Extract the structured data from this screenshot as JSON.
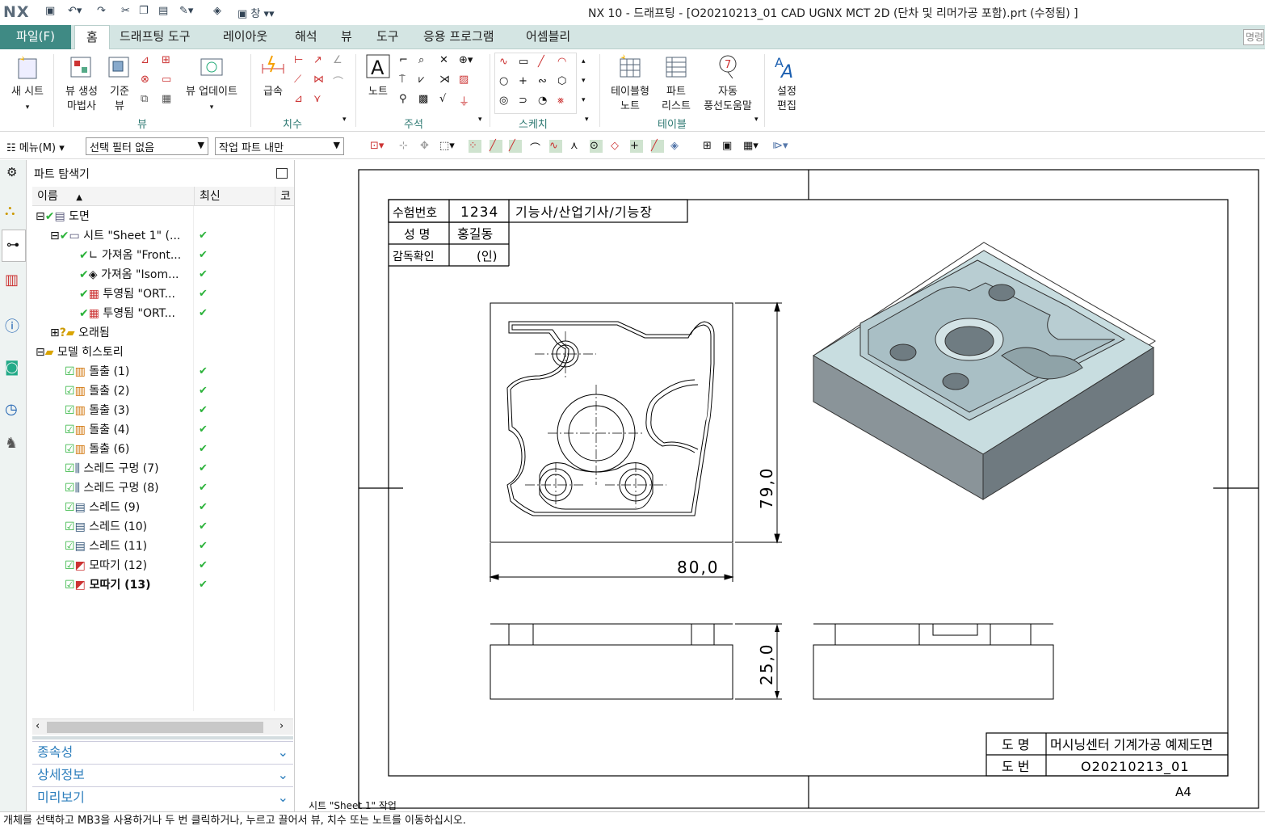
{
  "app": {
    "logo": "NX",
    "window_title": "NX 10 - 드래프팅 - [O20210213_01 CAD UGNX MCT 2D (단차 및 리머가공 포함).prt (수정됨) ]",
    "quick_access_window_label": "창"
  },
  "menubar": {
    "file": "파일(F)",
    "tabs": [
      "홈",
      "드래프팅 도구",
      "레이아웃",
      "해석",
      "뷰",
      "도구",
      "응용 프로그램",
      "어셈블리"
    ],
    "command_search_placeholder": "명령"
  },
  "ribbon": {
    "new_sheet": "새 시트",
    "view_wizard_1": "뷰 생성",
    "view_wizard_2": "마법사",
    "base_view_1": "기준",
    "base_view_2": "뷰",
    "update_view": "뷰 업데이트",
    "rapid_dim": "급속",
    "note": "노트",
    "tabular_note_1": "테이블형",
    "tabular_note_2": "노트",
    "parts_list_1": "파트",
    "parts_list_2": "리스트",
    "auto_balloon_1": "자동",
    "auto_balloon_2": "풍선도움말",
    "settings_1": "설정",
    "settings_2": "편집",
    "groups": [
      "뷰",
      "치수",
      "주석",
      "스케치",
      "테이블"
    ]
  },
  "toolbar2": {
    "menu": "메뉴(M)",
    "selection_filter": "선택 필터 없음",
    "work_part_scope": "작업 파트 내만"
  },
  "navigator": {
    "title": "파트 탐색기",
    "col_name": "이름",
    "col_uptodate": "최신",
    "col_comment": "코",
    "rows": [
      {
        "label": "도면",
        "indent": 0,
        "check": false
      },
      {
        "label": "시트 \"Sheet 1\" (...",
        "indent": 1,
        "check": true
      },
      {
        "label": "가져옴 \"Front...",
        "indent": 2,
        "check": true
      },
      {
        "label": "가져옴 \"Isom...",
        "indent": 2,
        "check": true
      },
      {
        "label": "투영됨 \"ORT...",
        "indent": 2,
        "check": true
      },
      {
        "label": "투영됨 \"ORT...",
        "indent": 2,
        "check": true
      },
      {
        "label": "오래됨",
        "indent": 1,
        "check": false
      },
      {
        "label": "모델 히스토리",
        "indent": 0,
        "check": false
      },
      {
        "label": "돌출 (1)",
        "indent": 2,
        "check": true
      },
      {
        "label": "돌출 (2)",
        "indent": 2,
        "check": true
      },
      {
        "label": "돌출 (3)",
        "indent": 2,
        "check": true
      },
      {
        "label": "돌출 (4)",
        "indent": 2,
        "check": true
      },
      {
        "label": "돌출 (6)",
        "indent": 2,
        "check": true
      },
      {
        "label": "스레드 구멍 (7)",
        "indent": 2,
        "check": true
      },
      {
        "label": "스레드 구멍 (8)",
        "indent": 2,
        "check": true
      },
      {
        "label": "스레드 (9)",
        "indent": 2,
        "check": true
      },
      {
        "label": "스레드 (10)",
        "indent": 2,
        "check": true
      },
      {
        "label": "스레드 (11)",
        "indent": 2,
        "check": true
      },
      {
        "label": "모따기 (12)",
        "indent": 2,
        "check": true
      },
      {
        "label": "모따기 (13)",
        "indent": 2,
        "check": true
      }
    ],
    "sections": [
      "종속성",
      "상세정보",
      "미리보기"
    ]
  },
  "drawing": {
    "table_exam_no_label": "수험번호",
    "table_exam_no_value": "1234",
    "table_grade": "기능사/산업기사/기능장",
    "table_name_label": "성 명",
    "table_name_value": "홍길동",
    "table_supervisor_label": "감독확인",
    "table_supervisor_value": "(인)",
    "dim_width": "80,0",
    "dim_height": "79,0",
    "dim_thickness": "25,0",
    "title_name_label": "도 명",
    "title_name_value": "머시닝센터 기계가공 예제도면",
    "title_no_label": "도 번",
    "title_no_value": "O20210213_01",
    "sheet_size": "A4",
    "sheet_status": "시트 \"Sheet 1\" 작업"
  },
  "statusbar": {
    "message": "개체를 선택하고 MB3을 사용하거나 두 번 클릭하거나, 누르고 끌어서 뷰, 치수 또는 노트를 이동하십시오."
  }
}
